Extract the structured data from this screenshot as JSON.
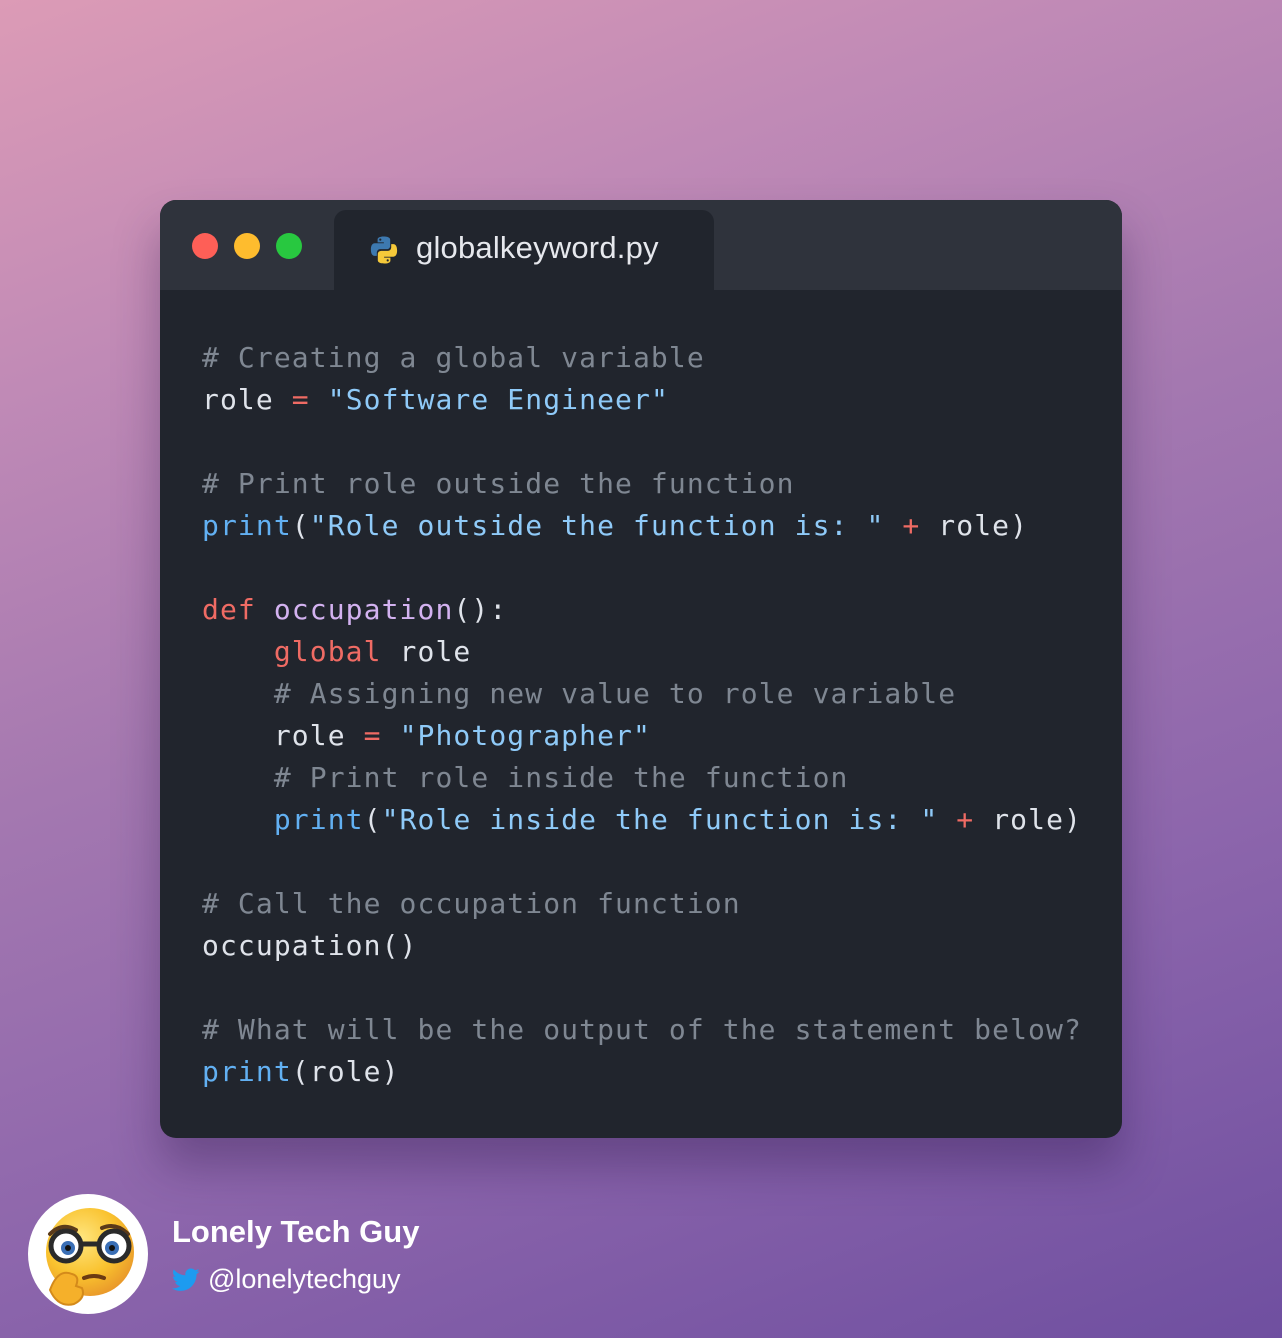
{
  "window": {
    "tab_filename": "globalkeyword.py",
    "tab_icon": "python-icon"
  },
  "code_lines": [
    [
      {
        "t": "# Creating a global variable",
        "k": "comment"
      }
    ],
    [
      {
        "t": "role ",
        "k": "plain"
      },
      {
        "t": "=",
        "k": "op"
      },
      {
        "t": " ",
        "k": "plain"
      },
      {
        "t": "\"Software Engineer\"",
        "k": "string"
      }
    ],
    [],
    [
      {
        "t": "# Print role outside the function",
        "k": "comment"
      }
    ],
    [
      {
        "t": "print",
        "k": "builtin"
      },
      {
        "t": "(",
        "k": "plain"
      },
      {
        "t": "\"Role outside the function is: \"",
        "k": "string"
      },
      {
        "t": " ",
        "k": "plain"
      },
      {
        "t": "+",
        "k": "op"
      },
      {
        "t": " role)",
        "k": "plain"
      }
    ],
    [],
    [
      {
        "t": "def",
        "k": "keyword"
      },
      {
        "t": " ",
        "k": "plain"
      },
      {
        "t": "occupation",
        "k": "func"
      },
      {
        "t": "():",
        "k": "plain"
      }
    ],
    [
      {
        "t": "    ",
        "k": "plain"
      },
      {
        "t": "global",
        "k": "keyword"
      },
      {
        "t": " role",
        "k": "plain"
      }
    ],
    [
      {
        "t": "    ",
        "k": "plain"
      },
      {
        "t": "# Assigning new value to role variable",
        "k": "comment"
      }
    ],
    [
      {
        "t": "    role ",
        "k": "plain"
      },
      {
        "t": "=",
        "k": "op"
      },
      {
        "t": " ",
        "k": "plain"
      },
      {
        "t": "\"Photographer\"",
        "k": "string"
      }
    ],
    [
      {
        "t": "    ",
        "k": "plain"
      },
      {
        "t": "# Print role inside the function",
        "k": "comment"
      }
    ],
    [
      {
        "t": "    ",
        "k": "plain"
      },
      {
        "t": "print",
        "k": "builtin"
      },
      {
        "t": "(",
        "k": "plain"
      },
      {
        "t": "\"Role inside the function is: \"",
        "k": "string"
      },
      {
        "t": " ",
        "k": "plain"
      },
      {
        "t": "+",
        "k": "op"
      },
      {
        "t": " role)",
        "k": "plain"
      }
    ],
    [],
    [
      {
        "t": "# Call the occupation function",
        "k": "comment"
      }
    ],
    [
      {
        "t": "occupation()",
        "k": "plain"
      }
    ],
    [],
    [
      {
        "t": "# What will be the output of the statement below?",
        "k": "comment"
      }
    ],
    [
      {
        "t": "print",
        "k": "builtin"
      },
      {
        "t": "(role)",
        "k": "plain"
      }
    ]
  ],
  "author": {
    "name": "Lonely Tech Guy",
    "handle": "@lonelytechguy",
    "handle_icon": "twitter-bird-icon",
    "avatar_icon": "nerd-thinking-emoji-icon"
  },
  "colors": {
    "close": "#fe5f57",
    "minimize": "#febc2e",
    "maximize": "#28c840",
    "editor_bg": "#21252d",
    "titlebar_bg": "#2f333c",
    "comment": "#7f8792",
    "string": "#8fcaf8",
    "builtin": "#62b0f2",
    "keyword": "#ef6b64",
    "function": "#d3b2f0"
  }
}
